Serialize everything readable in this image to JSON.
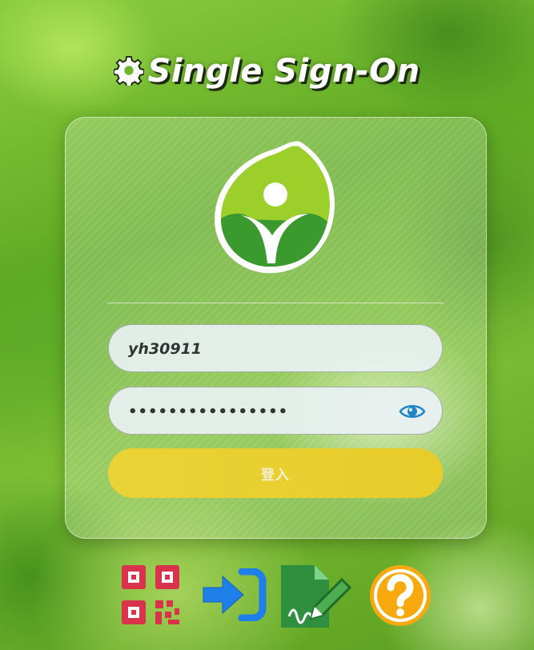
{
  "header": {
    "title": "Single Sign-On",
    "icon": "gear-icon"
  },
  "form": {
    "username_value": "yh30911",
    "password_value": "••••••••••••••••",
    "login_label": "登入",
    "show_password_icon": "eye-icon"
  },
  "toolbar": {
    "items": [
      {
        "icon": "qr-code-icon"
      },
      {
        "icon": "login-icon"
      },
      {
        "icon": "sign-document-icon"
      },
      {
        "icon": "help-icon"
      }
    ]
  },
  "colors": {
    "login_button": "#e9cf30",
    "eye_icon": "#1d86c8",
    "qr_icon": "#d8334a",
    "login_icon": "#1e7fe8",
    "sign_icon": "#2e8f3e",
    "help_icon": "#f7a90e",
    "logo_green": "#3a9a2e",
    "logo_light": "#9ccf2a"
  }
}
